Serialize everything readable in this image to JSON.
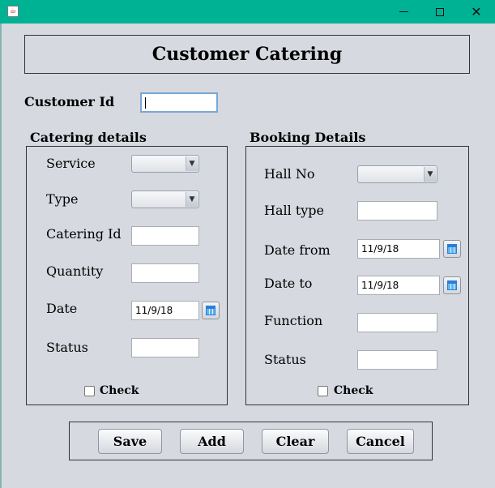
{
  "window": {
    "app_icon": "java-cup-icon",
    "controls": [
      "minimize",
      "maximize",
      "close"
    ],
    "close_glyph": "✕"
  },
  "header": {
    "title": "Customer Catering"
  },
  "customer": {
    "label": "Customer Id",
    "value": ""
  },
  "catering": {
    "title": "Catering details",
    "service_label": "Service",
    "service_value": "",
    "type_label": "Type",
    "type_value": "",
    "catering_id_label": "Catering Id",
    "catering_id_value": "",
    "quantity_label": "Quantity",
    "quantity_value": "",
    "date_label": "Date",
    "date_value": "11/9/18",
    "status_label": "Status",
    "status_value": "",
    "check_label": "Check"
  },
  "booking": {
    "title": "Booking Details",
    "hall_no_label": "Hall No",
    "hall_no_value": "",
    "hall_type_label": "Hall type",
    "hall_type_value": "",
    "date_from_label": "Date from",
    "date_from_value": "11/9/18",
    "date_to_label": "Date to",
    "date_to_value": "11/9/18",
    "function_label": "Function",
    "function_value": "",
    "status_label": "Status",
    "status_value": "",
    "check_label": "Check"
  },
  "buttons": {
    "save": "Save",
    "add": "Add",
    "clear": "Clear",
    "cancel": "Cancel"
  },
  "colors": {
    "titlebar": "#00b294",
    "background": "#d6d9df"
  }
}
